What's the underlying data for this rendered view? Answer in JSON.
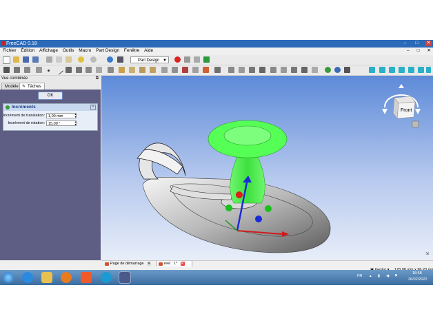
{
  "window": {
    "title": "FreeCAD 0.18",
    "min": "–",
    "max": "□",
    "close": "✕"
  },
  "menu": [
    "Fichier",
    "Édition",
    "Affichage",
    "Outils",
    "Macro",
    "Part Design",
    "Fenêtre",
    "Aide"
  ],
  "toolbar": {
    "workbench": "Part Design"
  },
  "combo_view": {
    "title": "Vue combinée",
    "tabs": [
      "Modèle",
      "Tâches"
    ],
    "ok_label": "OK",
    "panel_title": "Incréments",
    "translation_label": "Incrément de translation:",
    "translation_value": "1,00 mm",
    "rotation_label": "Incrément de rotation:",
    "rotation_value": "15,00 °"
  },
  "navcube": {
    "face": "Front"
  },
  "doc_tabs": [
    {
      "label": "Page de démarrage",
      "close": "✕"
    },
    {
      "label": "reel : 1*",
      "close": "✕"
    }
  ],
  "status": {
    "nav_style": "Gestur",
    "dimensions": "178,08 mm x 96,20 mm"
  },
  "taskbar": {
    "lang": "FR",
    "time": "18:58",
    "date": "26/02/2022"
  },
  "colors": {
    "accent": "#2a6ab8",
    "selection": "#55ff55",
    "viewport_top": "#5d8ad8"
  }
}
